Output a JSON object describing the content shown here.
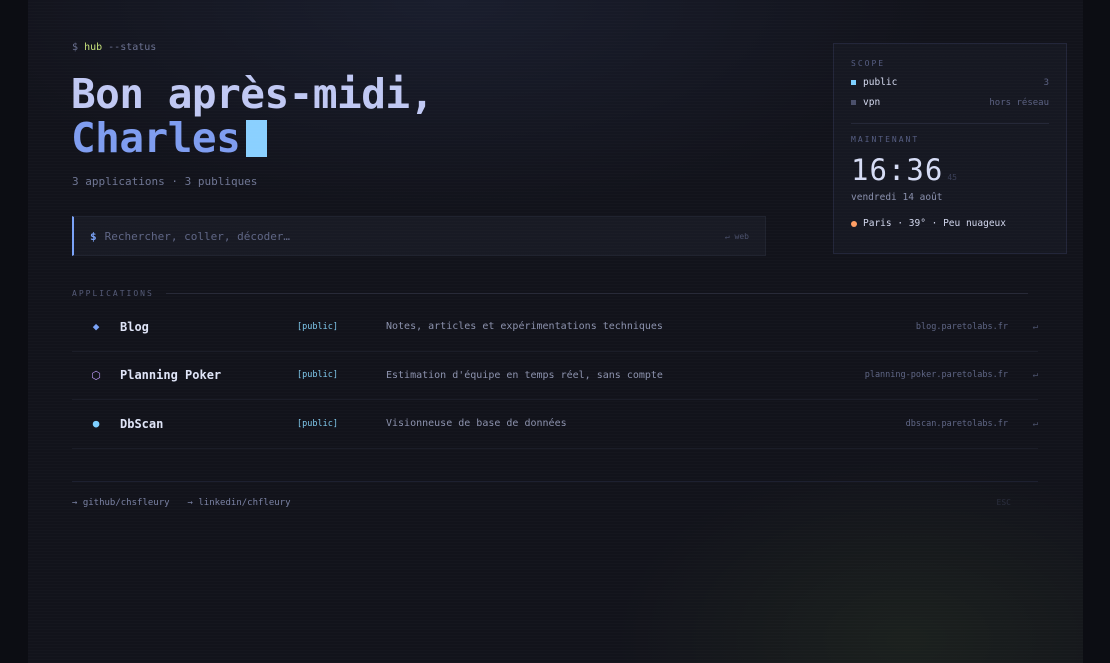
{
  "prompt": {
    "symbol": "$",
    "command": "hub",
    "flag": "--status"
  },
  "greeting": {
    "line1": "Bon après-midi,",
    "name": "Charles"
  },
  "summary": "3 applications · 3 publiques",
  "search": {
    "symbol": "$",
    "placeholder": "Rechercher, coller, décoder…",
    "hint": "↵ web"
  },
  "applications": {
    "heading": "APPLICATIONS",
    "items": [
      {
        "icon": "diamond-icon",
        "glyph": "◆",
        "color": "#7aa2f7",
        "title": "Blog",
        "badge": "[public]",
        "description": "Notes, articles et expérimentations techniques",
        "host": "blog.paretolabs.fr",
        "enter": "↵"
      },
      {
        "icon": "hexagon-icon",
        "glyph": "⬡",
        "color": "#bb9af7",
        "title": "Planning Poker",
        "badge": "[public]",
        "description": "Estimation d'équipe en temps réel, sans compte",
        "host": "planning-poker.paretolabs.fr",
        "enter": "↵"
      },
      {
        "icon": "circle-icon",
        "glyph": "●",
        "color": "#7dcfff",
        "title": "DbScan",
        "badge": "[public]",
        "description": "Visionneuse de base de données",
        "host": "dbscan.paretolabs.fr",
        "enter": "↵"
      }
    ]
  },
  "footer": {
    "links": [
      "→ github/chsfleury",
      "→ linkedin/chfleury"
    ],
    "tag": "ESC"
  },
  "panel": {
    "scope_label": "SCOPE",
    "scopes": [
      {
        "name": "public",
        "value": "3",
        "color": "#7dcfff"
      },
      {
        "name": "vpn",
        "value": "hors réseau",
        "color": "#4a4f6a"
      }
    ],
    "now_label": "MAINTENANT",
    "time": "16:36",
    "seconds": "45",
    "date": "vendredi 14 août",
    "weather": "Paris · 39° · Peu nuageux",
    "weather_color": "#ff9e64"
  }
}
